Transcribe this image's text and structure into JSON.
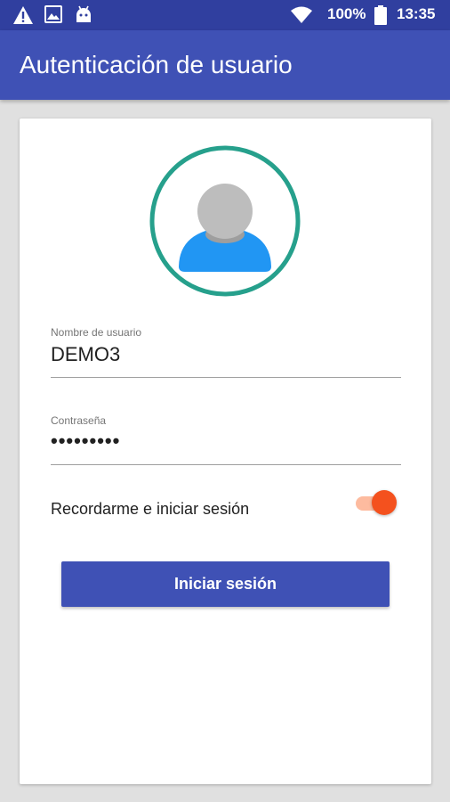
{
  "status_bar": {
    "battery": "100%",
    "time": "13:35",
    "icons": [
      "warning-icon",
      "image-icon",
      "android-icon",
      "wifi-icon",
      "battery-icon"
    ]
  },
  "app_bar": {
    "title": "Autenticación de usuario"
  },
  "form": {
    "username_label": "Nombre de usuario",
    "username_value": "DEMO3",
    "password_label": "Contraseña",
    "password_value": "•••••••••",
    "remember_label": "Recordarme e iniciar sesión",
    "remember_checked": true,
    "login_button": "Iniciar sesión"
  },
  "colors": {
    "status_bar": "#303f9f",
    "primary": "#3f51b5",
    "accent": "#f4511e",
    "avatar_ring": "#26a08c"
  }
}
